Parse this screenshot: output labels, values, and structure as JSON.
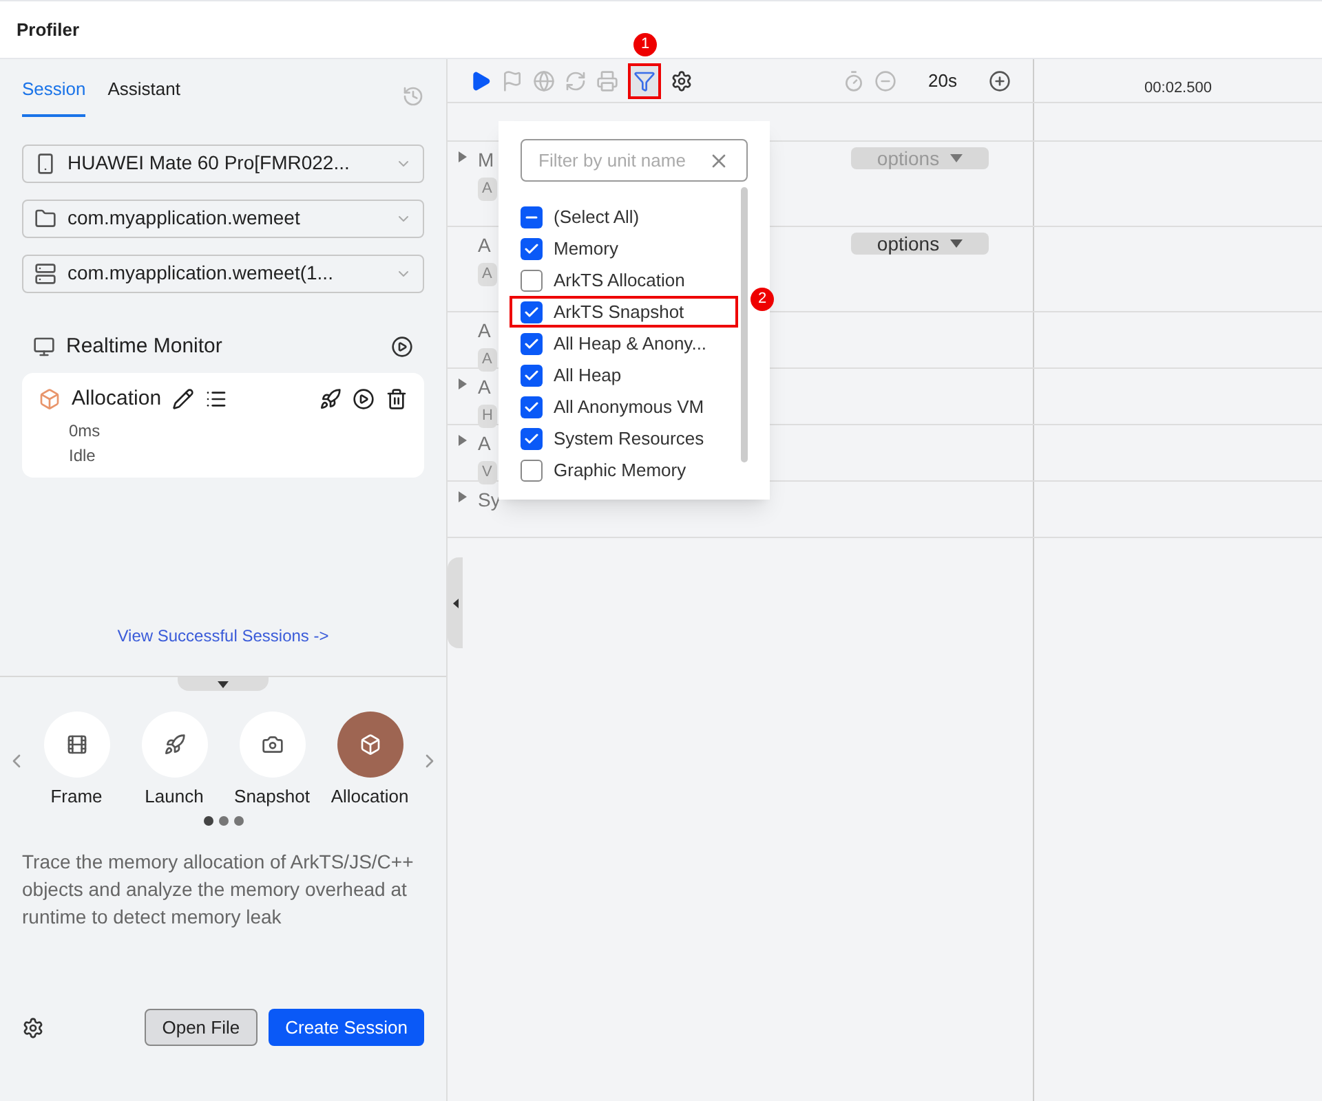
{
  "window": {
    "title": "Profiler"
  },
  "tabs": [
    {
      "label": "Session",
      "selected": true
    },
    {
      "label": "Assistant",
      "selected": false
    }
  ],
  "selects": [
    {
      "kind": "device",
      "value": "HUAWEI Mate 60 Pro[FMR022..."
    },
    {
      "kind": "app",
      "value": "com.myapplication.wemeet"
    },
    {
      "kind": "process",
      "value": "com.myapplication.wemeet(1..."
    }
  ],
  "realtime_monitor": {
    "title": "Realtime Monitor"
  },
  "session": {
    "name": "Allocation",
    "duration": "0ms",
    "status": "Idle"
  },
  "view_sessions_link": "View Successful Sessions ->",
  "templates": [
    {
      "kind": "frame",
      "label": "Frame",
      "selected": false
    },
    {
      "kind": "launch",
      "label": "Launch",
      "selected": false
    },
    {
      "kind": "snapshot",
      "label": "Snapshot",
      "selected": false
    },
    {
      "kind": "allocation",
      "label": "Allocation",
      "selected": true
    }
  ],
  "pager": [
    {
      "selected": true
    },
    {
      "selected": false
    },
    {
      "selected": false
    }
  ],
  "description": "Trace the memory allocation of ArkTS/JS/C++ objects and analyze the memory overhead at runtime to detect memory leak",
  "buttons": {
    "open": "Open File",
    "create": "Create Session"
  },
  "toolbar": {
    "duration": "20s"
  },
  "timeline": {
    "tick": "00:02.500"
  },
  "tracks": [
    {
      "name": "M",
      "badge": "A",
      "expander": true,
      "options": "options",
      "options_disabled": true
    },
    {
      "name": "A",
      "badge": "A",
      "expander": false,
      "options": "options",
      "options_disabled": false
    },
    {
      "name": "A",
      "badge": "A",
      "expander": false
    },
    {
      "name": "A",
      "badge": "H",
      "expander": true
    },
    {
      "name": "A",
      "badge": "V",
      "expander": true
    },
    {
      "name": "Sy",
      "expander": true
    }
  ],
  "filter": {
    "placeholder": "Filter by unit name",
    "items": [
      {
        "label": "(Select All)",
        "indeterminate": true
      },
      {
        "label": "Memory",
        "checked": true
      },
      {
        "label": "ArkTS Allocation",
        "checked": false
      },
      {
        "label": "ArkTS Snapshot",
        "checked": true,
        "highlighted": true
      },
      {
        "label": "All Heap & Anony...",
        "checked": true
      },
      {
        "label": "All Heap",
        "checked": true
      },
      {
        "label": "All Anonymous VM",
        "checked": true
      },
      {
        "label": "System Resources",
        "checked": true
      },
      {
        "label": "Graphic Memory",
        "checked": false
      }
    ]
  },
  "callouts": [
    "1",
    "2"
  ]
}
